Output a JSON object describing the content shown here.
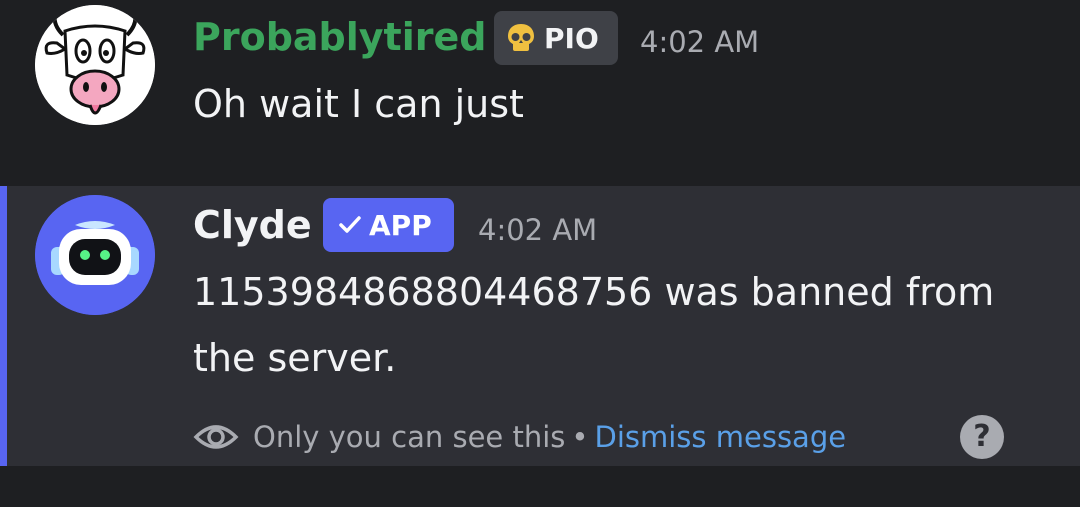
{
  "messages": [
    {
      "author": "Probablytired",
      "author_color": "#3ba55c",
      "tag": {
        "icon": "skull-icon",
        "label": "PIO"
      },
      "timestamp": "4:02 AM",
      "content": "Oh wait I can just",
      "avatar": "cow-avatar"
    },
    {
      "author": "Clyde",
      "author_color": "#f2f3f5",
      "tag": {
        "icon": "checkmark-icon",
        "label": "APP",
        "color": "#5865f2"
      },
      "timestamp": "4:02 AM",
      "content": "1153984868804468756 was banned from the server.",
      "avatar": "clyde-robot-avatar",
      "ephemeral": {
        "note": "Only you can see this",
        "separator": "•",
        "dismiss_label": "Dismiss message",
        "help_label": "?"
      }
    }
  ],
  "colors": {
    "background": "#1e1f22",
    "highlight_background": "#2e2f35",
    "accent": "#5865f2",
    "link": "#5aa0e8"
  }
}
